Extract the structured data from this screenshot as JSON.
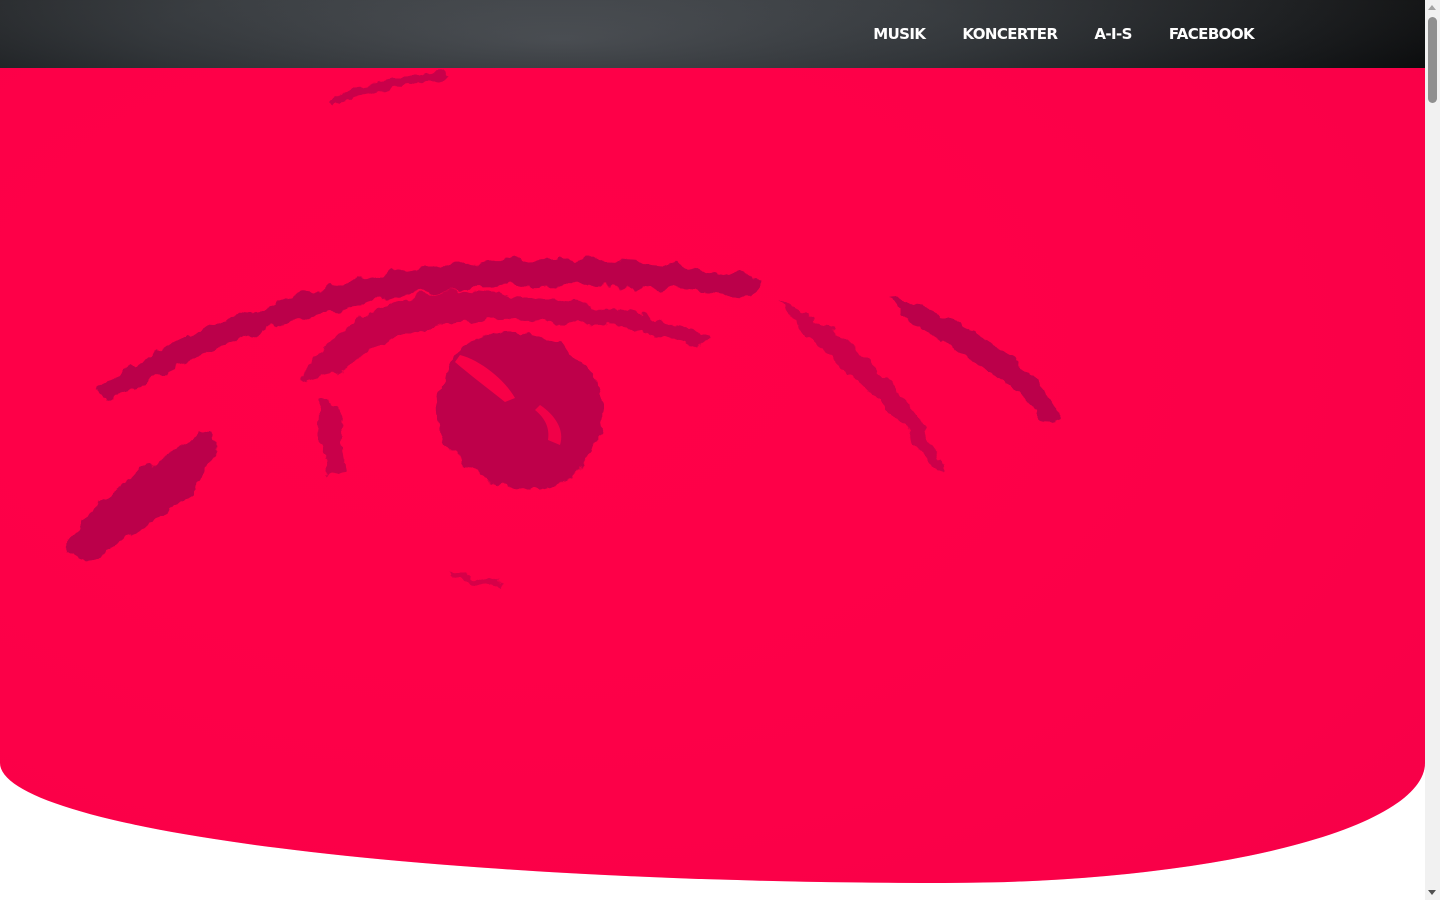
{
  "nav": {
    "items": [
      {
        "label": "MUSIK"
      },
      {
        "label": "KONCERTER"
      },
      {
        "label": "A-I-S"
      },
      {
        "label": "FACEBOOK"
      }
    ]
  },
  "hero": {
    "image": "eye-illustration",
    "background_color": "#ff0048",
    "ink_color": "#a0004a"
  },
  "colors": {
    "topbar": "#33373b",
    "nav_text": "#ffffff",
    "page_background": "#ffffff"
  }
}
